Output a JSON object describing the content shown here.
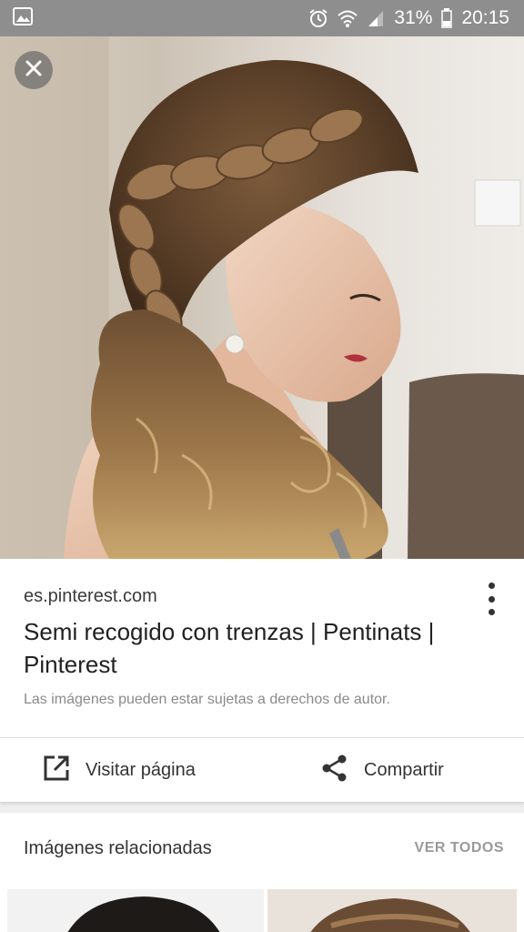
{
  "status_bar": {
    "battery": "31%",
    "time": "20:15"
  },
  "image": {
    "close_label": "close"
  },
  "result": {
    "source": "es.pinterest.com",
    "title": "Semi recogido con trenzas | Pentinats | Pinterest",
    "copyright_notice": "Las imágenes pueden estar sujetas a derechos de autor."
  },
  "actions": {
    "visit_label": "Visitar página",
    "share_label": "Compartir"
  },
  "related": {
    "title": "Imágenes relacionadas",
    "see_all": "VER TODOS"
  },
  "colors": {
    "status_bar": "#8e8e8e",
    "card": "#ffffff",
    "background": "#eeeeee"
  }
}
